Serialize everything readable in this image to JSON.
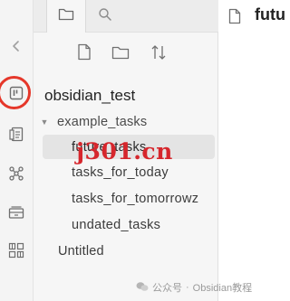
{
  "sidebar": {
    "tabs": [
      {
        "icon": "folder-icon"
      },
      {
        "icon": "search-icon"
      }
    ],
    "toolbar": [
      {
        "icon": "new-note-icon"
      },
      {
        "icon": "new-folder-icon"
      },
      {
        "icon": "sort-icon"
      }
    ],
    "tree": {
      "vault_name": "obsidian_test",
      "folder": {
        "label": "example_tasks",
        "expanded": true,
        "files": [
          {
            "label": "future_tasks",
            "active": true
          },
          {
            "label": "tasks_for_today"
          },
          {
            "label": "tasks_for_tomorrowz"
          },
          {
            "label": "undated_tasks"
          }
        ]
      },
      "root_files": [
        {
          "label": "Untitled"
        }
      ]
    }
  },
  "ribbon": {
    "icons": [
      "collapse-icon",
      "kanban-icon",
      "daily-note-icon",
      "graph-icon",
      "archive-icon",
      "plugins-icon"
    ],
    "highlight_color": "#e5372a"
  },
  "editor": {
    "tab_icon": "document-icon",
    "title": "futu"
  },
  "watermark": {
    "text": "j301.cn",
    "color": "#d6262c"
  },
  "footer": {
    "account_label": "公众号",
    "account_name": "Obsidian教程"
  }
}
